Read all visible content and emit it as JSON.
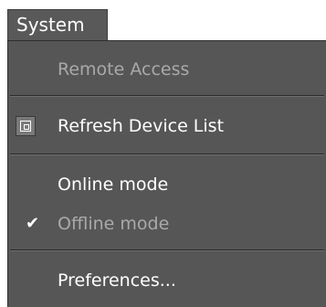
{
  "menubar": {
    "title": "System"
  },
  "menu": {
    "items": [
      {
        "label": "Remote Access",
        "enabled": false
      },
      {
        "label": "Refresh Device List",
        "enabled": true,
        "icon": "refresh-device-icon"
      },
      {
        "label": "Online mode",
        "enabled": true
      },
      {
        "label": "Offline mode",
        "enabled": false,
        "checked": true,
        "icon": "checkmark-icon"
      },
      {
        "label": "Preferences...",
        "enabled": true
      }
    ]
  }
}
